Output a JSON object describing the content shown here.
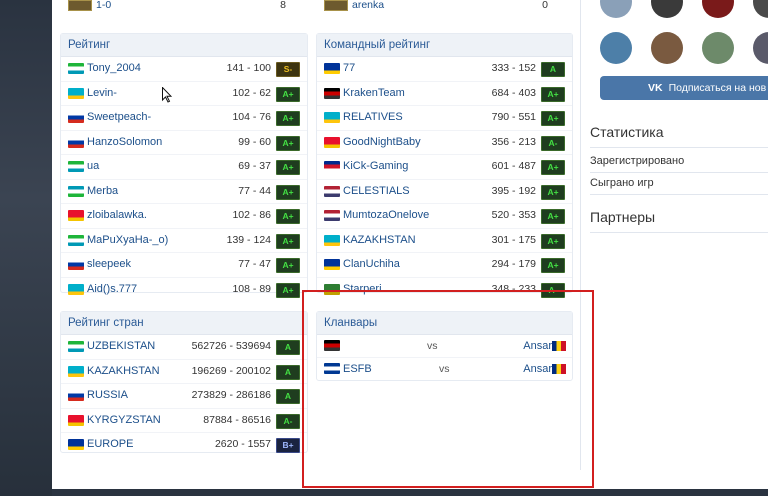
{
  "top_rows": {
    "left": {
      "name": "1-0",
      "score": "8"
    },
    "right": {
      "name": "arenka",
      "score": "0"
    }
  },
  "rating": {
    "title": "Рейтинг",
    "rows": [
      {
        "name": "Tony_2004",
        "score": "141 - 100",
        "badge": "S-",
        "flag_colors": [
          "#1eb53a",
          "#ffffff",
          "#0099b5"
        ]
      },
      {
        "name": "Levin-",
        "score": "102 - 62",
        "badge": "A+",
        "flag_colors": [
          "#00afca",
          "#00afca",
          "#fec50c"
        ]
      },
      {
        "name": "Sweetpeach-",
        "score": "104 - 76",
        "badge": "A+",
        "flag_colors": [
          "#ffffff",
          "#0039a6",
          "#d52b1e"
        ]
      },
      {
        "name": "HanzoSolomon",
        "score": "99 - 60",
        "badge": "A+",
        "flag_colors": [
          "#ffffff",
          "#0039a6",
          "#d52b1e"
        ]
      },
      {
        "name": "ua",
        "score": "69 - 37",
        "badge": "A+",
        "flag_colors": [
          "#1eb53a",
          "#ffffff",
          "#0099b5"
        ]
      },
      {
        "name": "Merba",
        "score": "77 - 44",
        "badge": "A+",
        "flag_colors": [
          "#0099b5",
          "#ffffff",
          "#1eb53a"
        ]
      },
      {
        "name": "zloibalawka.",
        "score": "102 - 86",
        "badge": "A+",
        "flag_colors": [
          "#e8112d",
          "#e8112d",
          "#f4c400"
        ]
      },
      {
        "name": "MaPuXyaHa-_o)",
        "score": "139 - 124",
        "badge": "A+",
        "flag_colors": [
          "#1eb53a",
          "#ffffff",
          "#0099b5"
        ]
      },
      {
        "name": "sleepeek",
        "score": "77 - 47",
        "badge": "A+",
        "flag_colors": [
          "#ffffff",
          "#0039a6",
          "#d52b1e"
        ]
      },
      {
        "name": "Aid()s.777",
        "score": "108 - 89",
        "badge": "A+",
        "flag_colors": [
          "#00afca",
          "#00afca",
          "#fec50c"
        ]
      }
    ]
  },
  "team_rating": {
    "title": "Командный рейтинг",
    "rows": [
      {
        "name": "77",
        "score": "333 - 152",
        "badge": "A",
        "flag_colors": [
          "#003399",
          "#003399",
          "#ffcc00"
        ]
      },
      {
        "name": "KrakenTeam",
        "score": "684 - 403",
        "badge": "A+",
        "flag_colors": [
          "#000000",
          "#cc0000",
          "#333333"
        ]
      },
      {
        "name": "RELATIVES",
        "score": "790 - 551",
        "badge": "A+",
        "flag_colors": [
          "#00afca",
          "#00afca",
          "#fec50c"
        ]
      },
      {
        "name": "GoodNightBaby",
        "score": "356 - 213",
        "badge": "A-",
        "flag_colors": [
          "#e8112d",
          "#e8112d",
          "#f4c400"
        ]
      },
      {
        "name": "KiCk-Gaming",
        "score": "601 - 487",
        "badge": "A+",
        "flag_colors": [
          "#002a8f",
          "#cf142b",
          "#ffffff"
        ]
      },
      {
        "name": "CELESTIALS",
        "score": "395 - 192",
        "badge": "A+",
        "flag_colors": [
          "#b22234",
          "#ffffff",
          "#3c3b6e"
        ]
      },
      {
        "name": "MumtozaOnelove",
        "score": "520 - 353",
        "badge": "A+",
        "flag_colors": [
          "#b22234",
          "#ffffff",
          "#3c3b6e"
        ]
      },
      {
        "name": "KAZAKHSTAN",
        "score": "301 - 175",
        "badge": "A+",
        "flag_colors": [
          "#00afca",
          "#00afca",
          "#fec50c"
        ]
      },
      {
        "name": "ClanUchiha",
        "score": "294 - 179",
        "badge": "A+",
        "flag_colors": [
          "#003399",
          "#003399",
          "#ffcc00"
        ]
      },
      {
        "name": "Starperi",
        "score": "348 - 233",
        "badge": "A-",
        "flag_colors": [
          "#2e7d32",
          "#2e7d32",
          "#c0a000"
        ]
      }
    ]
  },
  "country_rating": {
    "title": "Рейтинг стран",
    "rows": [
      {
        "name": "UZBEKISTAN",
        "score": "562726 - 539694",
        "badge": "A",
        "flag_colors": [
          "#1eb53a",
          "#ffffff",
          "#0099b5"
        ]
      },
      {
        "name": "KAZAKHSTAN",
        "score": "196269 - 200102",
        "badge": "A",
        "flag_colors": [
          "#00afca",
          "#00afca",
          "#fec50c"
        ]
      },
      {
        "name": "RUSSIA",
        "score": "273829 - 286186",
        "badge": "A",
        "flag_colors": [
          "#ffffff",
          "#0039a6",
          "#d52b1e"
        ]
      },
      {
        "name": "KYRGYZSTAN",
        "score": "87884 - 86516",
        "badge": "A-",
        "flag_colors": [
          "#e8112d",
          "#e8112d",
          "#f4c400"
        ]
      },
      {
        "name": "EUROPE",
        "score": "2620 - 1557",
        "badge": "B+",
        "flag_colors": [
          "#003399",
          "#003399",
          "#ffcc00"
        ]
      }
    ]
  },
  "clanwars": {
    "title": "Кланвары",
    "rows": [
      {
        "left": "",
        "vs": "vs",
        "right": "Ansar",
        "left_flag_colors": [
          "#000000",
          "#cc0000",
          "#333333"
        ]
      },
      {
        "left": "ESFB",
        "vs": "vs",
        "right": "Ansar",
        "left_flag_colors": [
          "#003893",
          "#ffffff",
          "#003893"
        ]
      }
    ]
  },
  "sidebar": {
    "subscribe_label": "Подписаться на нов",
    "vk_label": "VK",
    "stats_title": "Статистика",
    "stats_items": [
      "Зарегистрировано",
      "Сыграно игр"
    ],
    "partners_title": "Партнеры"
  },
  "colors": {
    "accent": "#4a76a8",
    "highlight": "#d21f1f",
    "badge_green": "#44e044"
  }
}
